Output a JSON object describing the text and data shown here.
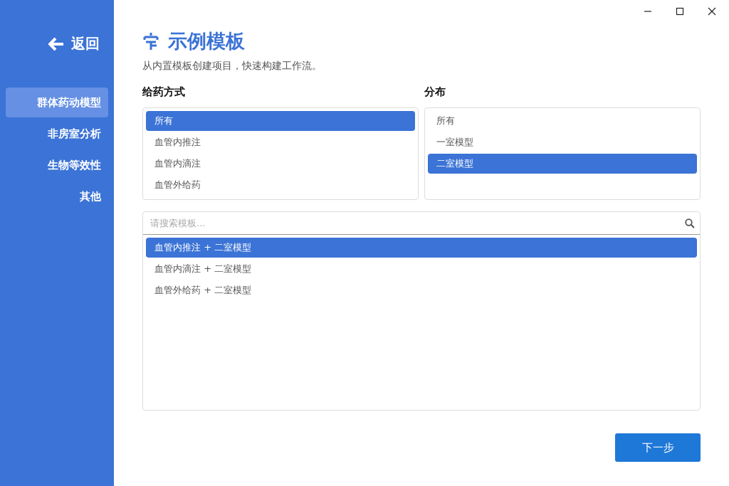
{
  "sidebar": {
    "back": "返回",
    "items": [
      {
        "label": "群体药动模型",
        "selected": true
      },
      {
        "label": "非房室分析",
        "selected": false
      },
      {
        "label": "生物等效性",
        "selected": false
      },
      {
        "label": "其他",
        "selected": false
      }
    ]
  },
  "header": {
    "title": "示例模板",
    "subtitle": "从内置模板创建项目，快速构建工作流。"
  },
  "filters": [
    {
      "heading": "给药方式",
      "options": [
        {
          "label": "所有",
          "selected": true
        },
        {
          "label": "血管内推注",
          "selected": false
        },
        {
          "label": "血管内滴注",
          "selected": false
        },
        {
          "label": "血管外给药",
          "selected": false
        }
      ]
    },
    {
      "heading": "分布",
      "options": [
        {
          "label": "所有",
          "selected": false
        },
        {
          "label": "一室模型",
          "selected": false
        },
        {
          "label": "二室模型",
          "selected": true
        }
      ]
    }
  ],
  "search": {
    "placeholder": "请搜索模板..."
  },
  "templates": [
    {
      "label": "血管内推注 + 二室模型",
      "selected": true
    },
    {
      "label": "血管内滴注 + 二室模型",
      "selected": false
    },
    {
      "label": "血管外给药 + 二室模型",
      "selected": false
    }
  ],
  "next_button": "下一步"
}
